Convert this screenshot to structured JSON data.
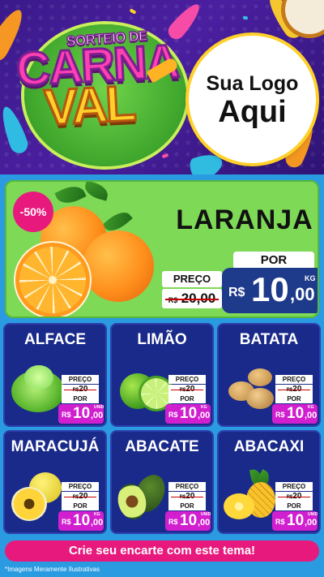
{
  "header": {
    "title_line1": "SORTEIO DE",
    "title_line2": "CARNA",
    "title_line3": "VAL",
    "logo_placeholder_line1": "Sua Logo",
    "logo_placeholder_line2": "Aqui"
  },
  "featured": {
    "discount": "-50%",
    "name": "LARANJA",
    "old_price_label": "PREÇO",
    "old_price_currency": "R$",
    "old_price": "20,00",
    "new_price_label": "POR",
    "new_price_currency": "R$",
    "new_price_int": "10",
    "new_price_dec": ",00",
    "unit": "KG"
  },
  "products": [
    {
      "name": "ALFACE",
      "label_old": "PREÇO",
      "currency_old": "R$",
      "old": "20",
      "label_new": "POR",
      "currency": "R$",
      "int": "10",
      "dec": ",00",
      "unit": "UNID"
    },
    {
      "name": "LIMÃO",
      "label_old": "PREÇO",
      "currency_old": "R$",
      "old": "20",
      "label_new": "POR",
      "currency": "R$",
      "int": "10",
      "dec": ",00",
      "unit": "KG"
    },
    {
      "name": "BATATA",
      "label_old": "PREÇO",
      "currency_old": "R$",
      "old": "20",
      "label_new": "POR",
      "currency": "R$",
      "int": "10",
      "dec": ",00",
      "unit": "KG"
    },
    {
      "name": "MARACUJÁ",
      "label_old": "PREÇO",
      "currency_old": "R$",
      "old": "20",
      "label_new": "POR",
      "currency": "R$",
      "int": "10",
      "dec": ",00",
      "unit": "KG"
    },
    {
      "name": "ABACATE",
      "label_old": "PREÇO",
      "currency_old": "R$",
      "old": "20",
      "label_new": "POR",
      "currency": "R$",
      "int": "10",
      "dec": ",00",
      "unit": "UNID"
    },
    {
      "name": "ABACAXI",
      "label_old": "PREÇO",
      "currency_old": "R$",
      "old": "20",
      "label_new": "POR",
      "currency": "R$",
      "int": "10",
      "dec": ",00",
      "unit": "UNID"
    }
  ],
  "footer": {
    "cta": "Crie seu encarte com este tema!",
    "disclaimer": "*Imagens Meramente Ilustrativas"
  },
  "colors": {
    "accent_pink": "#e8197d",
    "featured_green": "#7ed957",
    "card_blue": "#1a2a8a",
    "price_magenta": "#d11fd0",
    "background_blue": "#2a9be0"
  }
}
